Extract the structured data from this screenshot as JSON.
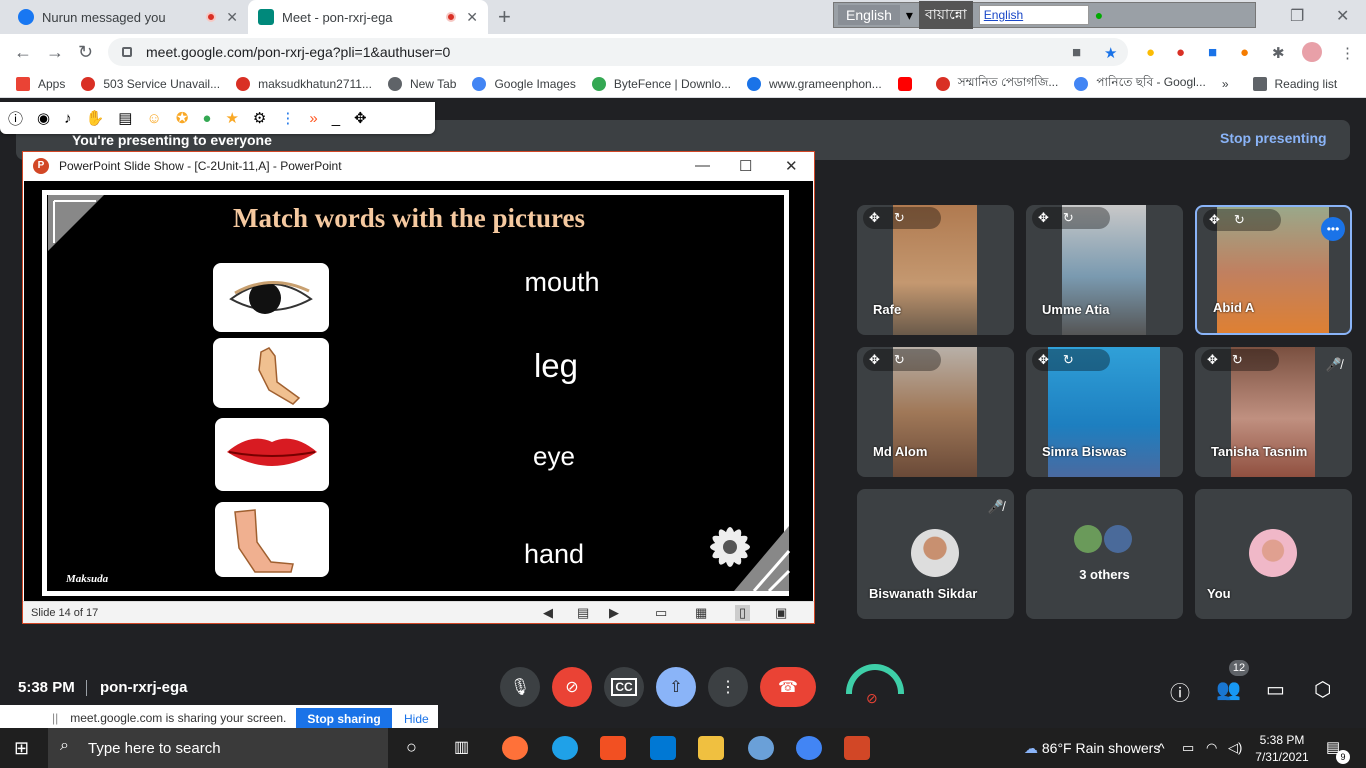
{
  "tabs": [
    {
      "title": "Nurun messaged you",
      "favicon_color": "#1877f2"
    },
    {
      "title": "Meet - pon-rxrj-ega",
      "favicon_color": "#00897b"
    }
  ],
  "lang_bar": {
    "language": "English",
    "bengali": "বায়ান্নো",
    "input": "English"
  },
  "address_bar": {
    "url": "meet.google.com/pon-rxrj-ega?pli=1&authuser=0"
  },
  "bookmarks": [
    {
      "label": "Apps",
      "color": "#ea4335"
    },
    {
      "label": "503 Service Unavail...",
      "color": "#d93025"
    },
    {
      "label": "maksudkhatun2711...",
      "color": "#d93025"
    },
    {
      "label": "New Tab",
      "color": "#5f6368"
    },
    {
      "label": "Google Images",
      "color": "#4285f4"
    },
    {
      "label": "ByteFence | Downlo...",
      "color": "#34a853"
    },
    {
      "label": "www.grameenphon...",
      "color": "#1a73e8"
    },
    {
      "label": "সম্মানিত পেডাগজি...",
      "color": "#d93025"
    },
    {
      "label": "পানিতে ছবি - Googl...",
      "color": "#4285f4"
    }
  ],
  "reading_list": "Reading list",
  "presenting": {
    "banner": "You're presenting to everyone",
    "stop_label": "Stop presenting"
  },
  "ppt": {
    "window_title": "PowerPoint Slide Show - [C-2Unit-11,A] - PowerPoint",
    "slide_title": "Match words with the pictures",
    "words": [
      "mouth",
      "leg",
      "eye",
      "hand"
    ],
    "author": "Maksuda",
    "status": "Slide 14 of 17"
  },
  "participants": [
    {
      "name": "Rafe"
    },
    {
      "name": "Umme Atia"
    },
    {
      "name": "Abid A"
    },
    {
      "name": "Md Alom"
    },
    {
      "name": "Simra Biswas"
    },
    {
      "name": "Tanisha Tasnim"
    },
    {
      "name": "Biswanath Sikdar"
    },
    {
      "name": "3 others"
    },
    {
      "name": "You"
    }
  ],
  "bottom": {
    "time": "5:38 PM",
    "meeting_code": "pon-rxrj-ega",
    "participant_count": "12"
  },
  "share_notice": {
    "text": "meet.google.com is sharing your screen.",
    "stop": "Stop sharing",
    "hide": "Hide"
  },
  "taskbar": {
    "search_placeholder": "Type here to search",
    "weather": "86°F  Rain showers",
    "time": "5:38 PM",
    "date": "7/31/2021",
    "notifications": "9"
  }
}
